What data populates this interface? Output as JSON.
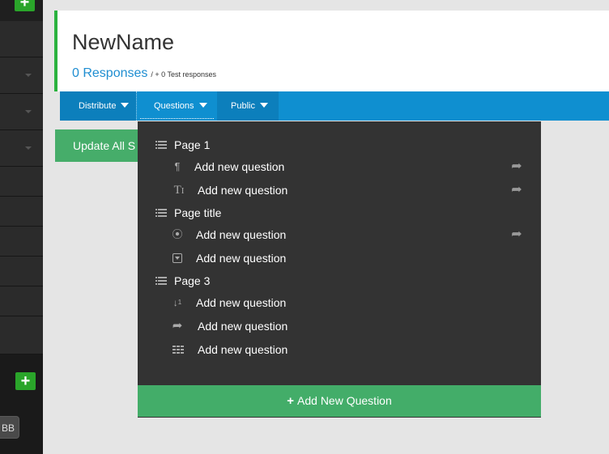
{
  "survey": {
    "name": "NewName",
    "responses": "0 Responses",
    "test_responses": "/ + 0 Test responses"
  },
  "tabs": [
    {
      "label": "Distribute"
    },
    {
      "label": "Questions"
    },
    {
      "label": "Public"
    }
  ],
  "update_button": "Update All S",
  "sidebar": {
    "tag": "BB"
  },
  "dropdown": {
    "rows": [
      {
        "type": "page",
        "label": "Page 1",
        "icon": "list-icon"
      },
      {
        "type": "question",
        "label": "Add new question",
        "icon": "paragraph-icon",
        "share": true
      },
      {
        "type": "question",
        "label": "Add new question",
        "icon": "text-input-icon",
        "share": true
      },
      {
        "type": "page",
        "label": "Page title",
        "icon": "list-icon"
      },
      {
        "type": "question",
        "label": "Add new question",
        "icon": "radio-icon",
        "share": true
      },
      {
        "type": "question",
        "label": "Add new question",
        "icon": "dropdown-icon",
        "share": false
      },
      {
        "type": "page",
        "label": "Page 3",
        "icon": "list-icon"
      },
      {
        "type": "question",
        "label": "Add new question",
        "icon": "sort-numeric-icon",
        "share": false
      },
      {
        "type": "question",
        "label": "Add new question",
        "icon": "share-icon",
        "share": false
      },
      {
        "type": "question",
        "label": "Add new question",
        "icon": "grid-icon",
        "share": false
      }
    ],
    "add_new_label": "Add New Question"
  },
  "colors": {
    "accent_blue": "#0f8fd0",
    "green": "#43ad69",
    "dropdown_bg": "#333333"
  }
}
